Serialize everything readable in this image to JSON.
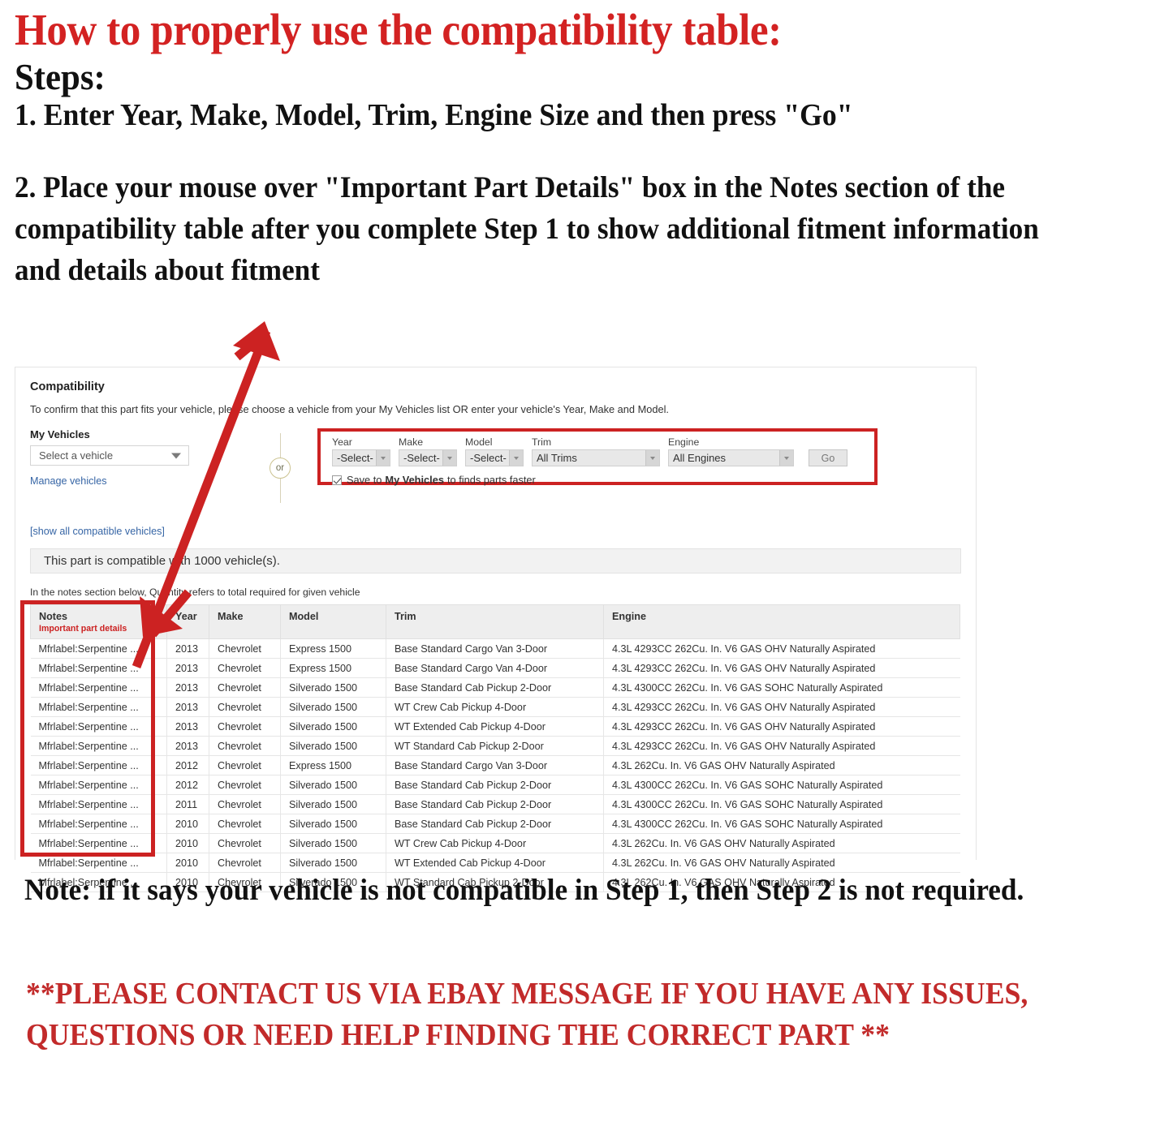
{
  "headings": {
    "title": "How to properly use the compatibility table:",
    "steps_label": "Steps:",
    "step1": "1. Enter Year, Make, Model, Trim, Engine Size and then press \"Go\"",
    "step2": "2. Place your mouse over \"Important Part Details\" box in the Notes section of the compatibility table after you complete Step 1 to show additional fitment information and details about fitment"
  },
  "compatibility": {
    "heading": "Compatibility",
    "subheading": "To confirm that this part fits your vehicle, please choose a vehicle from your My Vehicles list OR enter your vehicle's Year, Make and Model.",
    "my_vehicles": {
      "label": "My Vehicles",
      "select_value": "Select a vehicle",
      "manage_link": "Manage vehicles"
    },
    "or_label": "or",
    "selectors": {
      "year": {
        "label": "Year",
        "value": "-Select-"
      },
      "make": {
        "label": "Make",
        "value": "-Select-"
      },
      "model": {
        "label": "Model",
        "value": "-Select-"
      },
      "trim": {
        "label": "Trim",
        "value": "All Trims"
      },
      "engine": {
        "label": "Engine",
        "value": "All Engines"
      },
      "go_button": "Go"
    },
    "save_checkbox": {
      "prefix": "Save to",
      "bold": "My Vehicles",
      "suffix": "to finds parts faster",
      "checked": true
    },
    "show_all_link": "[show all compatible vehicles]",
    "compat_banner": "This part is compatible with 1000 vehicle(s).",
    "qty_note": "In the notes section below, Quantity refers to total required for given vehicle",
    "table": {
      "columns": [
        "Notes",
        "Year",
        "Make",
        "Model",
        "Trim",
        "Engine"
      ],
      "notes_subheader": "Important part details",
      "rows": [
        [
          "Mfrlabel:Serpentine ...",
          "2013",
          "Chevrolet",
          "Express 1500",
          "Base Standard Cargo Van 3-Door",
          "4.3L 4293CC 262Cu. In. V6 GAS OHV Naturally Aspirated"
        ],
        [
          "Mfrlabel:Serpentine ...",
          "2013",
          "Chevrolet",
          "Express 1500",
          "Base Standard Cargo Van 4-Door",
          "4.3L 4293CC 262Cu. In. V6 GAS OHV Naturally Aspirated"
        ],
        [
          "Mfrlabel:Serpentine ...",
          "2013",
          "Chevrolet",
          "Silverado 1500",
          "Base Standard Cab Pickup 2-Door",
          "4.3L 4300CC 262Cu. In. V6 GAS SOHC Naturally Aspirated"
        ],
        [
          "Mfrlabel:Serpentine ...",
          "2013",
          "Chevrolet",
          "Silverado 1500",
          "WT Crew Cab Pickup 4-Door",
          "4.3L 4293CC 262Cu. In. V6 GAS OHV Naturally Aspirated"
        ],
        [
          "Mfrlabel:Serpentine ...",
          "2013",
          "Chevrolet",
          "Silverado 1500",
          "WT Extended Cab Pickup 4-Door",
          "4.3L 4293CC 262Cu. In. V6 GAS OHV Naturally Aspirated"
        ],
        [
          "Mfrlabel:Serpentine ...",
          "2013",
          "Chevrolet",
          "Silverado 1500",
          "WT Standard Cab Pickup 2-Door",
          "4.3L 4293CC 262Cu. In. V6 GAS OHV Naturally Aspirated"
        ],
        [
          "Mfrlabel:Serpentine ...",
          "2012",
          "Chevrolet",
          "Express 1500",
          "Base Standard Cargo Van 3-Door",
          "4.3L 262Cu. In. V6 GAS OHV Naturally Aspirated"
        ],
        [
          "Mfrlabel:Serpentine ...",
          "2012",
          "Chevrolet",
          "Silverado 1500",
          "Base Standard Cab Pickup 2-Door",
          "4.3L 4300CC 262Cu. In. V6 GAS SOHC Naturally Aspirated"
        ],
        [
          "Mfrlabel:Serpentine ...",
          "2011",
          "Chevrolet",
          "Silverado 1500",
          "Base Standard Cab Pickup 2-Door",
          "4.3L 4300CC 262Cu. In. V6 GAS SOHC Naturally Aspirated"
        ],
        [
          "Mfrlabel:Serpentine ...",
          "2010",
          "Chevrolet",
          "Silverado 1500",
          "Base Standard Cab Pickup 2-Door",
          "4.3L 4300CC 262Cu. In. V6 GAS SOHC Naturally Aspirated"
        ],
        [
          "Mfrlabel:Serpentine ...",
          "2010",
          "Chevrolet",
          "Silverado 1500",
          "WT Crew Cab Pickup 4-Door",
          "4.3L 262Cu. In. V6 GAS OHV Naturally Aspirated"
        ],
        [
          "Mfrlabel:Serpentine ...",
          "2010",
          "Chevrolet",
          "Silverado 1500",
          "WT Extended Cab Pickup 4-Door",
          "4.3L 262Cu. In. V6 GAS OHV Naturally Aspirated"
        ],
        [
          "Mfrlabel:Serpentine ...",
          "2010",
          "Chevrolet",
          "Silverado 1500",
          "WT Standard Cab Pickup 2-Door",
          "4.3L 262Cu. In. V6 GAS OHV Naturally Aspirated"
        ]
      ]
    }
  },
  "footer": {
    "note": "Note: if it says your vehicle is not compatible in Step 1, then Step 2 is not required.",
    "contact": "**PLEASE CONTACT US VIA EBAY MESSAGE IF YOU HAVE ANY ISSUES, QUESTIONS OR NEED HELP FINDING THE CORRECT PART **"
  },
  "colors": {
    "accent_red": "#cc2222",
    "heading_red": "#d32222",
    "link_blue": "#3665a5"
  }
}
